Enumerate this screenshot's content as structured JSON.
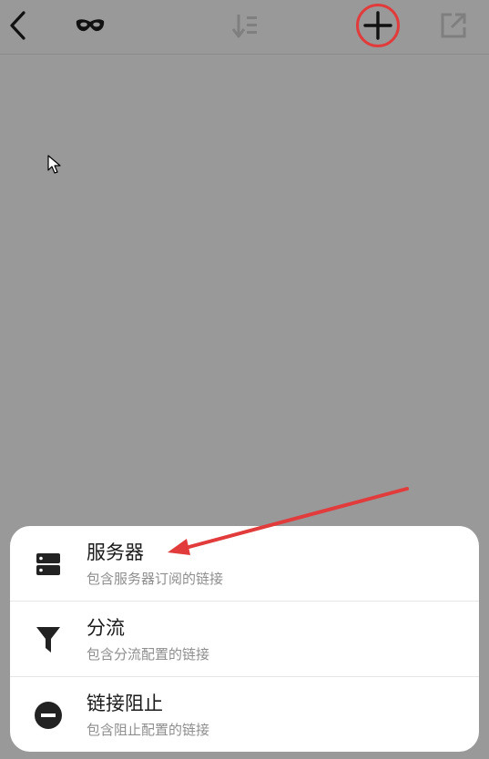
{
  "toolbar": {
    "back_icon": "chevron-left-icon",
    "incognito_icon": "mask-icon",
    "sort_icon": "sort-icon",
    "add_icon": "plus-icon",
    "export_icon": "open-external-icon"
  },
  "menu": {
    "items": [
      {
        "title": "服务器",
        "subtitle": "包含服务器订阅的链接",
        "icon": "server-icon"
      },
      {
        "title": "分流",
        "subtitle": "包含分流配置的链接",
        "icon": "filter-icon"
      },
      {
        "title": "链接阻止",
        "subtitle": "包含阻止配置的链接",
        "icon": "block-icon"
      }
    ]
  },
  "colors": {
    "overlay": "#999999",
    "highlight": "#e23b3b",
    "sheet": "#ffffff"
  }
}
